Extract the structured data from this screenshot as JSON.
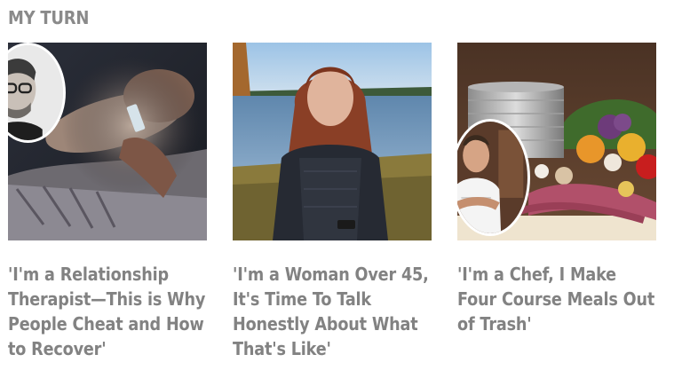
{
  "section": {
    "title": "MY TURN"
  },
  "cards": [
    {
      "headline": "'I'm a Relationship Therapist—This is Why People Cheat and How to Recover'"
    },
    {
      "headline": "'I'm a Woman Over 45, It's Time To Talk Honestly About What That's Like'"
    },
    {
      "headline": "'I'm a Chef, I Make Four Course Meals Out of Trash'"
    }
  ],
  "colors": {
    "title": "#8a8a8a",
    "headline": "#828282",
    "background": "#ffffff"
  }
}
